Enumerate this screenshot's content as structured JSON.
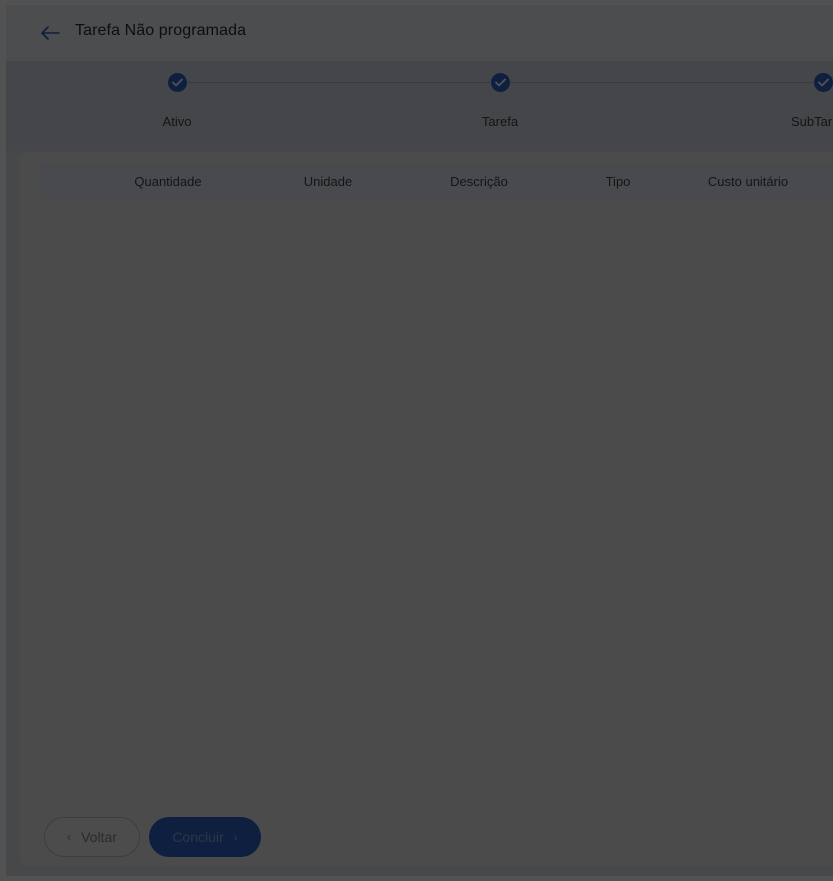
{
  "header": {
    "title": "Tarefa Não programada",
    "back_icon": "arrow-left-icon"
  },
  "stepper": {
    "steps": [
      {
        "label": "Ativo",
        "state": "completed"
      },
      {
        "label": "Tarefa",
        "state": "completed"
      },
      {
        "label": "SubTar",
        "state": "completed"
      }
    ]
  },
  "table": {
    "columns": [
      "Quantidade",
      "Unidade",
      "Descrição",
      "Tipo",
      "Custo unitário"
    ],
    "rows": []
  },
  "footer": {
    "back_label": "Voltar",
    "finish_label": "Concluir"
  },
  "colors": {
    "primary": "#2d60c8",
    "overlay": "rgba(0,0,0,0.68)"
  }
}
